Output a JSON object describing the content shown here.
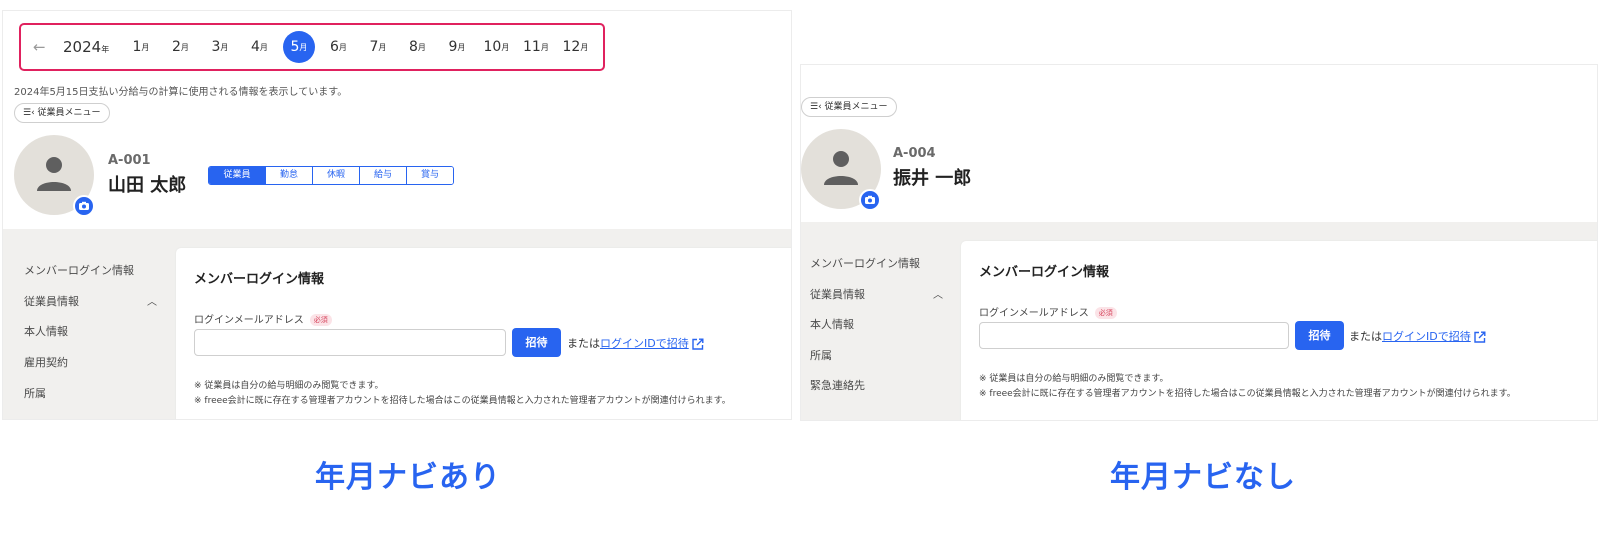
{
  "left": {
    "nav": {
      "arrow": "←",
      "year": "2024",
      "year_unit": "年",
      "month_unit": "月",
      "months": [
        "1",
        "2",
        "3",
        "4",
        "5",
        "6",
        "7",
        "8",
        "9",
        "10",
        "11",
        "12"
      ],
      "active_month": "5"
    },
    "description": "2024年5月15日支払い分給与の計算に使用される情報を表示しています。",
    "employee_menu": "☰‹ 従業員メニュー",
    "employee": {
      "code": "A-001",
      "name": "山田 太郎"
    },
    "tabs": [
      {
        "label": "従業員",
        "active": true
      },
      {
        "label": "勤怠",
        "active": false
      },
      {
        "label": "休暇",
        "active": false
      },
      {
        "label": "給与",
        "active": false
      },
      {
        "label": "賞与",
        "active": false
      }
    ],
    "sidebar": [
      "メンバーログイン情報",
      "従業員情報",
      "本人情報",
      "雇用契約",
      "所属"
    ],
    "card": {
      "title": "メンバーログイン情報",
      "field_label": "ログインメールアドレス",
      "required": "必須",
      "invite_button": "招待",
      "or_text": "または",
      "login_id_link": "ログインIDで招待",
      "note1": "※ 従業員は自分の給与明細のみ閲覧できます。",
      "note2": "※ freee会計に既に存在する管理者アカウントを招待した場合はこの従業員情報と入力された管理者アカウントが関連付けられます。"
    },
    "caption": "年月ナビあり"
  },
  "right": {
    "employee_menu": "☰‹ 従業員メニュー",
    "employee": {
      "code": "A-004",
      "name": "振井 一郎"
    },
    "sidebar": [
      "メンバーログイン情報",
      "従業員情報",
      "本人情報",
      "所属",
      "緊急連絡先"
    ],
    "card": {
      "title": "メンバーログイン情報",
      "field_label": "ログインメールアドレス",
      "required": "必須",
      "invite_button": "招待",
      "or_text": "または",
      "login_id_link": "ログインIDで招待",
      "note1": "※ 従業員は自分の給与明細のみ閲覧できます。",
      "note2": "※ freee会計に既に存在する管理者アカウントを招待した場合はこの従業員情報と入力された管理者アカウントが関連付けられます。"
    },
    "caption": "年月ナビなし"
  },
  "colors": {
    "accent": "#2864f0",
    "highlight_border": "#e0215e",
    "required": "#d6425a"
  },
  "icons": [
    "arrow-left-icon",
    "person-icon",
    "camera-icon",
    "chevron-up-icon",
    "external-link-icon"
  ]
}
